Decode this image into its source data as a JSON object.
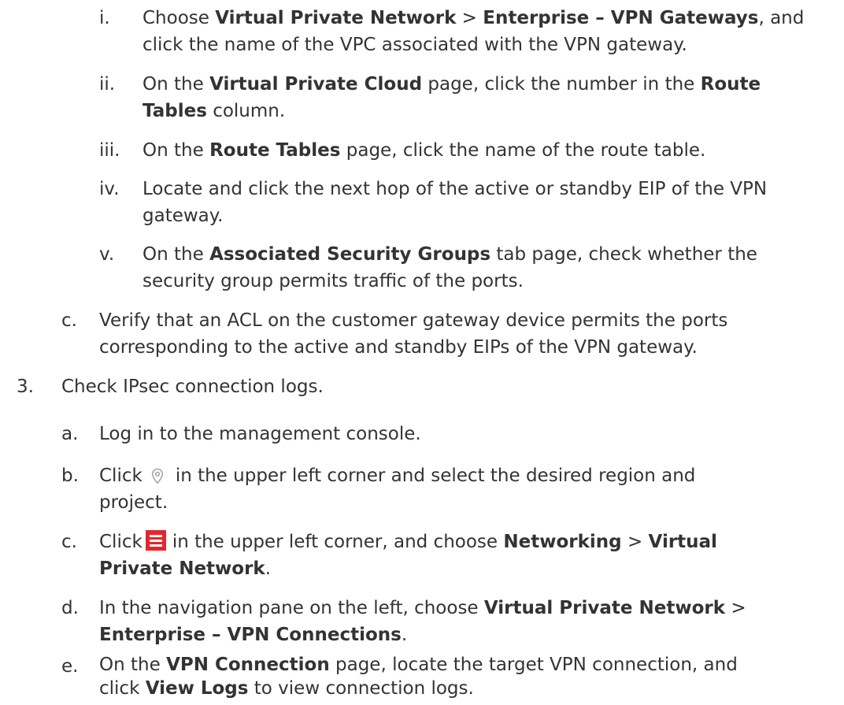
{
  "colors": {
    "text": "#333333",
    "menu_icon_bg": "#e3262f",
    "pin_icon": "#a6a6a6"
  },
  "icons": {
    "region": "map-pin-icon",
    "menu": "hamburger-menu-icon"
  },
  "step_i": {
    "marker": "i.",
    "t1": "Choose ",
    "b1": "Virtual Private Network",
    "t2": " > ",
    "b2": "Enterprise – VPN Gateways",
    "t3": ", and",
    "t4": "click the name of the VPC associated with the VPN gateway."
  },
  "step_ii": {
    "marker": "ii.",
    "t1": "On the ",
    "b1": "Virtual Private Cloud",
    "t2": " page, click the number in the ",
    "b2": "Route",
    "b3": "Tables",
    "t3": " column."
  },
  "step_iii": {
    "marker": "iii.",
    "t1": "On the ",
    "b1": "Route Tables",
    "t2": " page, click the name of the route table."
  },
  "step_iv": {
    "marker": "iv.",
    "t1": "Locate and click the next hop of the active or standby EIP of the VPN",
    "t2": "gateway."
  },
  "step_v": {
    "marker": "v.",
    "t1": "On the ",
    "b1": "Associated Security Groups",
    "t2": " tab page, check whether the",
    "t3": "security group permits traffic of the ports."
  },
  "step_c1": {
    "marker": "c.",
    "t1": "Verify that an ACL on the customer gateway device permits the ports",
    "t2": "corresponding to the active and standby EIPs of the VPN gateway."
  },
  "step_3": {
    "marker": "3.",
    "t1": "Check IPsec connection logs."
  },
  "step_a": {
    "marker": "a.",
    "t1": "Log in to the management console."
  },
  "step_b": {
    "marker": "b.",
    "t1": "Click",
    "t2": "in the upper left corner and select the desired region and",
    "t3": "project."
  },
  "step_c2": {
    "marker": "c.",
    "t1": "Click",
    "t2": "in the upper left corner, and choose ",
    "b1": "Networking",
    "t3": " > ",
    "b2": "Virtual",
    "b3": "Private Network",
    "t4": "."
  },
  "step_d": {
    "marker": "d.",
    "t1": "In the navigation pane on the left, choose ",
    "b1": "Virtual Private Network",
    "t2": " >",
    "b2": "Enterprise – VPN Connections",
    "t3": "."
  },
  "step_e": {
    "marker": "e.",
    "t1": "On the ",
    "b1": "VPN Connection",
    "t2": " page, locate the target VPN connection, and",
    "t3": "click ",
    "b2": "View Logs",
    "t4": " to view connection logs."
  }
}
